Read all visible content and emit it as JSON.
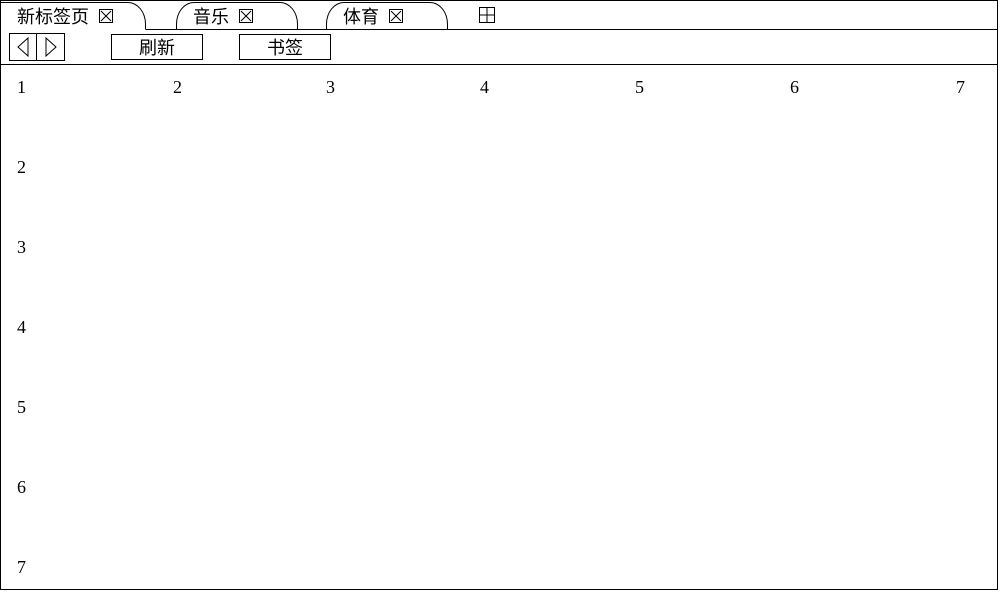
{
  "tabs": [
    {
      "label": "新标签页",
      "active": true
    },
    {
      "label": "音乐",
      "active": false
    },
    {
      "label": "体育",
      "active": false
    }
  ],
  "icons": {
    "close": "close-icon",
    "add_tab": "add-tab-icon",
    "back": "back-arrow-icon",
    "forward": "forward-arrow-icon"
  },
  "toolbar": {
    "refresh_label": "刷新",
    "bookmark_label": "书签"
  },
  "grid": {
    "columns": [
      "1",
      "2",
      "3",
      "4",
      "5",
      "6",
      "7"
    ],
    "rows": [
      "2",
      "3",
      "4",
      "5",
      "6",
      "7"
    ]
  }
}
